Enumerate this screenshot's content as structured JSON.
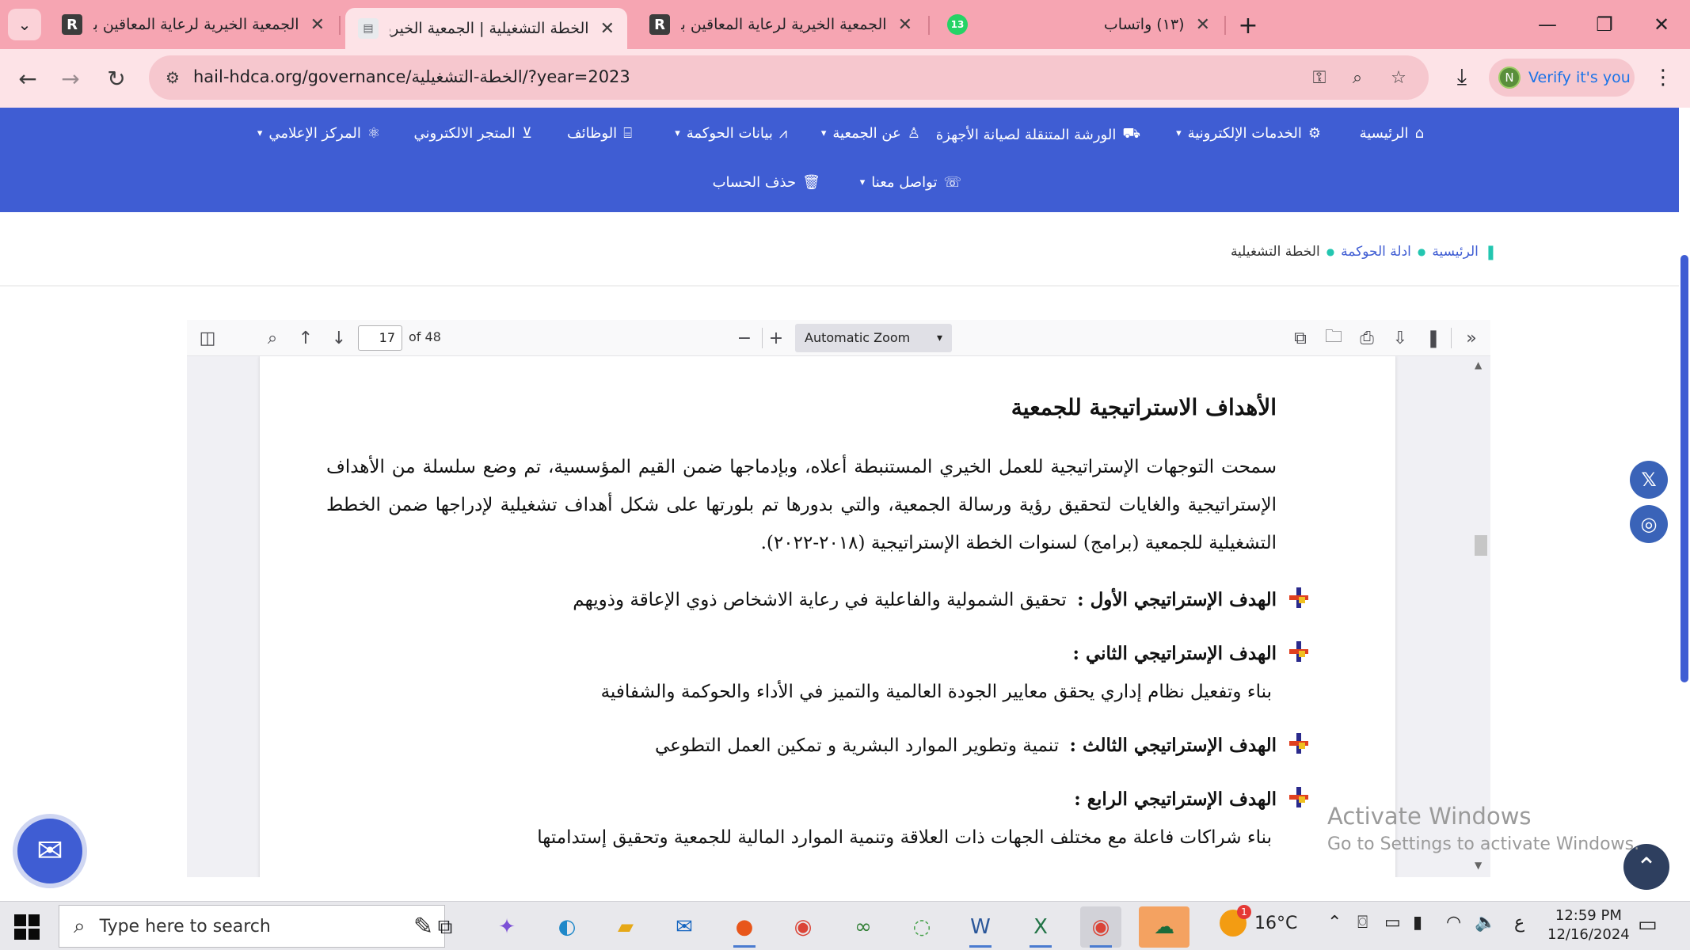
{
  "browser": {
    "tabs": [
      {
        "title": "الجمعية الخيرية لرعاية المعاقين بحائل",
        "close": "✕"
      },
      {
        "title": "الخطة التشغيلية | الجمعية الخيرية",
        "close": "✕"
      },
      {
        "title": "الجمعية الخيرية لرعاية المعاقين بحائل",
        "close": "✕"
      },
      {
        "title": "(١٣) واتساب",
        "close": "✕",
        "badge": "13"
      }
    ],
    "url": "hail-hdca.org/governance/الخطة-التشغيلية/?year=2023",
    "verify_label": "Verify it's you",
    "profile_initial": "N"
  },
  "site_nav": {
    "row1": [
      {
        "label": "الرئيسية",
        "icon": "home-icon",
        "caret": false
      },
      {
        "label": "الخدمات الإلكترونية",
        "icon": "gears-icon",
        "caret": true
      },
      {
        "label": "الورشة المتنقلة لصيانة الأجهزة",
        "icon": "truck-icon",
        "caret": false
      },
      {
        "label": "عن الجمعية",
        "icon": "person-icon",
        "caret": true
      },
      {
        "label": "بيانات الحوكمة",
        "icon": "chart-icon",
        "caret": true
      },
      {
        "label": "الوظائف",
        "icon": "briefcase-icon",
        "caret": false
      },
      {
        "label": "المتجر الالكتروني",
        "icon": "cart-icon",
        "caret": false
      },
      {
        "label": "المركز الإعلامي",
        "icon": "atom-icon",
        "caret": true
      }
    ],
    "row2": [
      {
        "label": "تواصل معنا",
        "icon": "chat-icon",
        "caret": true
      },
      {
        "label": "حذف الحساب",
        "icon": "trash-icon",
        "caret": false
      }
    ]
  },
  "breadcrumb": {
    "home": "الرئيسية",
    "parent": "ادلة الحوكمة",
    "current": "الخطة التشغيلية"
  },
  "pdf": {
    "page_number": "17",
    "page_count": "of 48",
    "zoom": "Automatic Zoom",
    "heading": "الأهداف الاستراتيجية للجمعية",
    "paragraph": "سمحت التوجهات الإستراتيجية للعمل الخيري المستنبطة أعلاه، وبإدماجها ضمن القيم المؤسسية، تم وضع سلسلة من الأهداف الإستراتيجية والغايات لتحقيق رؤية ورسالة الجمعية، والتي بدورها تم بلورتها على شكل أهداف تشغيلية لإدراجها ضمن الخطط التشغيلية للجمعية (برامج) لسنوات الخطة الإستراتيجية (٢٠١٨-٢٠٢٢).",
    "goals": [
      {
        "label": "الهدف الإستراتيجي الأول :",
        "text": "تحقيق الشمولية والفاعلية في رعاية الاشخاص ذوي الإعاقة وذويهم"
      },
      {
        "label": "الهدف الإستراتيجي الثاني :",
        "text": "بناء وتفعيل نظام إداري يحقق معايير الجودة العالمية والتميز في الأداء والحوكمة والشفافية"
      },
      {
        "label": "الهدف الإستراتيجي الثالث :",
        "text": "تنمية وتطوير الموارد البشرية و تمكين العمل التطوعي"
      },
      {
        "label": "الهدف الإستراتيجي الرابع :",
        "text": "بناء شراكات فاعلة مع مختلف الجهات ذات العلاقة وتنمية الموارد المالية للجمعية وتحقيق إستدامتها"
      }
    ]
  },
  "watermark": {
    "line1": "Activate Windows",
    "line2": "Go to Settings to activate Windows."
  },
  "taskbar": {
    "search_placeholder": "Type here to search",
    "temperature": "16°C",
    "weather_badge": "1",
    "lang": "ع",
    "time": "12:59 PM",
    "date": "12/16/2024"
  },
  "colors": {
    "tab_strip": "#f6a5b2",
    "site_nav": "#3f5dd3",
    "accent_teal": "#23c6b0"
  }
}
